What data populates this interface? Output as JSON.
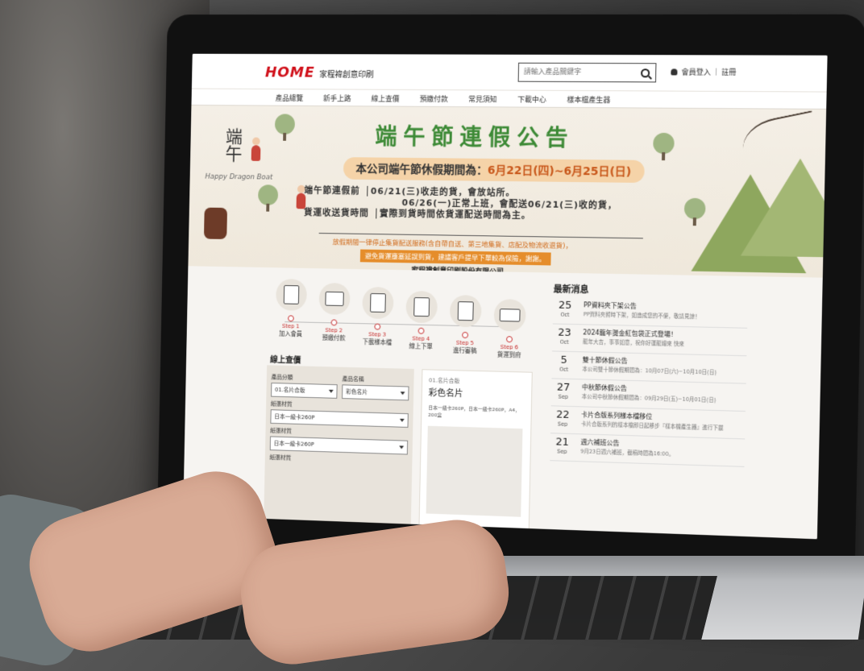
{
  "header": {
    "logo_mark": "HOME",
    "logo_text": "家程禕創意印刷",
    "search_placeholder": "請輸入產品關鍵字",
    "login_label": "會員登入",
    "separator": "|",
    "register_label": "註冊"
  },
  "nav": {
    "items": [
      {
        "label": "產品總覽"
      },
      {
        "label": "新手上路"
      },
      {
        "label": "線上查價"
      },
      {
        "label": "預繳付款"
      },
      {
        "label": "常見須知"
      },
      {
        "label": "下載中心"
      },
      {
        "label": "樣本檔產生器"
      }
    ]
  },
  "banner": {
    "title": "端午節連假公告",
    "pill_prefix": "本公司端午節休假期間為：",
    "pill_dates": "6月22日(四)~6月25日(日)",
    "line1_label": "端午節連假前",
    "line1_text": "06/21(三)收走的貨，會放站所。",
    "line2_text": "06/26(一)正常上班，會配送06/21(三)收的貨，",
    "line3_label": "貨運收送貨時間",
    "line3_text": "實際到貨時間依貨運配送時間為主。",
    "note": "放假期間一律停止集貨配送服務(含自帶自送、第三地集貨、店配及物流收退貨)，",
    "highlight": "避免貨運壅塞延誤到貨，建議客戶提早下單較為保險，謝謝。",
    "company": "家程禕創意印刷股份有限公司",
    "deco_vertical": "端午",
    "deco_sub": "Happy Dragon Boat"
  },
  "steps": [
    {
      "num": "Step 1",
      "label": "加入會員"
    },
    {
      "num": "Step 2",
      "label": "預繳付款"
    },
    {
      "num": "Step 3",
      "label": "下載樣本檔"
    },
    {
      "num": "Step 4",
      "label": "線上下單"
    },
    {
      "num": "Step 5",
      "label": "進行審稿"
    },
    {
      "num": "Step 6",
      "label": "貨運到府"
    }
  ],
  "lookup": {
    "title": "線上查價",
    "category_label": "產品分類",
    "category_value": "01.名片合版",
    "name_label": "產品名稱",
    "name_value": "彩色名片",
    "paper_label": "紙張材質",
    "paper_value": "日本一級卡260P",
    "paper2_label": "紙張材質",
    "paper2_value": "日本一級卡260P",
    "more_label": "紙張材質"
  },
  "product": {
    "code": "01.名片合版",
    "name": "彩色名片",
    "spec": "日本一級卡260P，日本一級卡260P，A4，200盒"
  },
  "news": {
    "title": "最新消息",
    "items": [
      {
        "day": "25",
        "mon": "Oct",
        "head": "PP資料夾下架公告",
        "desc": "PP資料夾暫時下架，如造成您的不便，敬請見諒！"
      },
      {
        "day": "23",
        "mon": "Oct",
        "head": "2024龍年燙金紅包袋正式登場！",
        "desc": "龍年大吉，事事如意，祝你好運龍總來 快來"
      },
      {
        "day": "5",
        "mon": "Oct",
        "head": "雙十節休假公告",
        "desc": "本公司雙十節休假期間為：10月07日(六)~10月10日(日)"
      },
      {
        "day": "27",
        "mon": "Sep",
        "head": "中秋節休假公告",
        "desc": "本公司中秋節休假期間為：09月29日(五)~10月01日(日)"
      },
      {
        "day": "22",
        "mon": "Sep",
        "head": "卡片合版系列樣本檔移位",
        "desc": "卡片合版系列的樣本檔即日起移步『樣本檔產生器』進行下載"
      },
      {
        "day": "21",
        "mon": "Sep",
        "head": "週六補班公告",
        "desc": "9月23日週六補班，截稿時間為16:00。"
      }
    ]
  }
}
